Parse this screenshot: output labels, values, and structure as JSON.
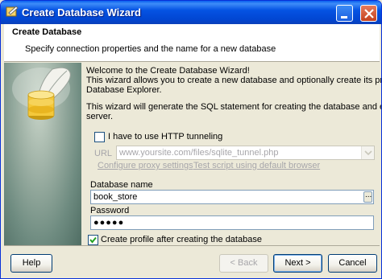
{
  "window": {
    "title": "Create Database Wizard",
    "icon": "database-wizard-icon"
  },
  "header": {
    "title": "Create Database",
    "subtitle": "Specify connection properties and the name for a new database"
  },
  "intro": {
    "line1": "Welcome to the Create Database Wizard!",
    "line2": "This wizard allows you to create a new database and optionally create its profile in the",
    "line3": "Database Explorer.",
    "line4": "This wizard will generate the SQL statement for creating the database and execute it on the",
    "line5": "server."
  },
  "http": {
    "label": "I have to use HTTP tunneling",
    "checked": false,
    "url_label": "URL",
    "url_value": "www.yoursite.com/files/sqlite_tunnel.php",
    "proxy_link": "Configure proxy settings",
    "test_link": "Test script using default browser"
  },
  "database": {
    "name_label": "Database name",
    "name_value": "book_store",
    "browse_label": "...",
    "password_label": "Password",
    "password_mask": "●●●●●"
  },
  "profile": {
    "label": "Create profile after creating the database",
    "checked": true
  },
  "buttons": {
    "help": "Help",
    "back": "< Back",
    "next": "Next >",
    "cancel": "Cancel"
  },
  "colors": {
    "title_bar": "#0553E3",
    "accent_border": "#0831D9",
    "disabled_text": "#A7A6AA",
    "dialog_bg": "#ECE9D8"
  }
}
